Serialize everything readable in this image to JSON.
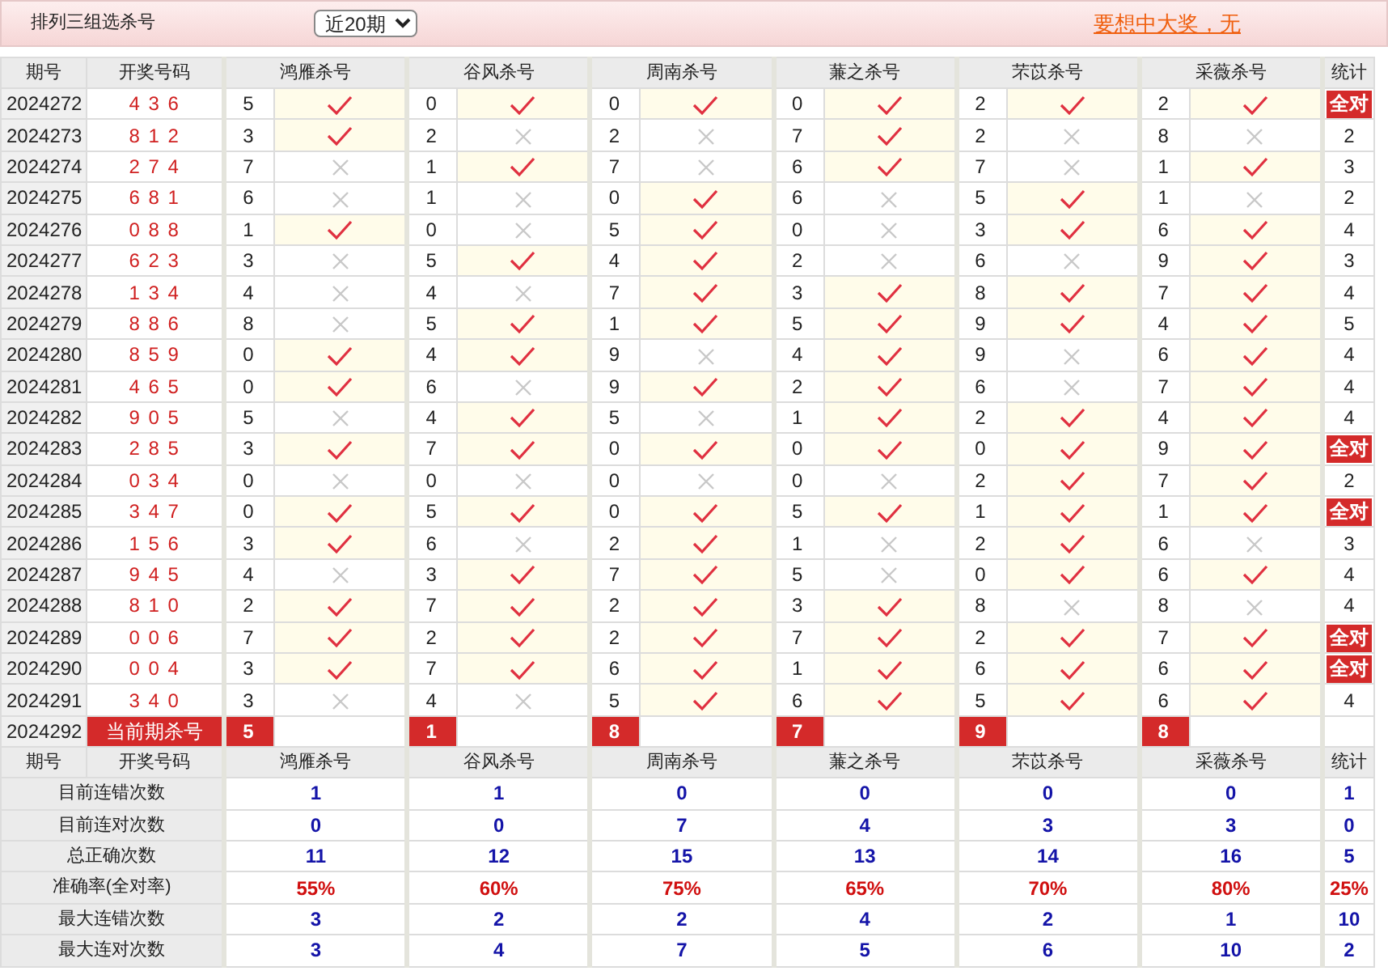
{
  "header": {
    "title": "排列三组选杀号",
    "period_select": {
      "value": "近20期"
    },
    "promo_link": "要想中大奖，无"
  },
  "table": {
    "columns": [
      "期号",
      "开奖号码",
      "鸿雁杀号",
      "谷风杀号",
      "周南杀号",
      "蒹之杀号",
      "芣苡杀号",
      "采薇杀号",
      "统计"
    ],
    "rows": [
      {
        "period": "2024272",
        "draw": "4 3 6",
        "kills": [
          {
            "number": "5",
            "hit": true
          },
          {
            "number": "0",
            "hit": true
          },
          {
            "number": "0",
            "hit": true
          },
          {
            "number": "0",
            "hit": true
          },
          {
            "number": "2",
            "hit": true
          },
          {
            "number": "2",
            "hit": true
          }
        ],
        "stat": {
          "kind": "all",
          "text": "全对"
        }
      },
      {
        "period": "2024273",
        "draw": "8 1 2",
        "kills": [
          {
            "number": "3",
            "hit": true
          },
          {
            "number": "2",
            "hit": false
          },
          {
            "number": "2",
            "hit": false
          },
          {
            "number": "7",
            "hit": true
          },
          {
            "number": "2",
            "hit": false
          },
          {
            "number": "8",
            "hit": false
          }
        ],
        "stat": {
          "kind": "count",
          "text": "2"
        }
      },
      {
        "period": "2024274",
        "draw": "2 7 4",
        "kills": [
          {
            "number": "7",
            "hit": false
          },
          {
            "number": "1",
            "hit": true
          },
          {
            "number": "7",
            "hit": false
          },
          {
            "number": "6",
            "hit": true
          },
          {
            "number": "7",
            "hit": false
          },
          {
            "number": "1",
            "hit": true
          }
        ],
        "stat": {
          "kind": "count",
          "text": "3"
        }
      },
      {
        "period": "2024275",
        "draw": "6 8 1",
        "kills": [
          {
            "number": "6",
            "hit": false
          },
          {
            "number": "1",
            "hit": false
          },
          {
            "number": "0",
            "hit": true
          },
          {
            "number": "6",
            "hit": false
          },
          {
            "number": "5",
            "hit": true
          },
          {
            "number": "1",
            "hit": false
          }
        ],
        "stat": {
          "kind": "count",
          "text": "2"
        }
      },
      {
        "period": "2024276",
        "draw": "0 8 8",
        "kills": [
          {
            "number": "1",
            "hit": true
          },
          {
            "number": "0",
            "hit": false
          },
          {
            "number": "5",
            "hit": true
          },
          {
            "number": "0",
            "hit": false
          },
          {
            "number": "3",
            "hit": true
          },
          {
            "number": "6",
            "hit": true
          }
        ],
        "stat": {
          "kind": "count",
          "text": "4"
        }
      },
      {
        "period": "2024277",
        "draw": "6 2 3",
        "kills": [
          {
            "number": "3",
            "hit": false
          },
          {
            "number": "5",
            "hit": true
          },
          {
            "number": "4",
            "hit": true
          },
          {
            "number": "2",
            "hit": false
          },
          {
            "number": "6",
            "hit": false
          },
          {
            "number": "9",
            "hit": true
          }
        ],
        "stat": {
          "kind": "count",
          "text": "3"
        }
      },
      {
        "period": "2024278",
        "draw": "1 3 4",
        "kills": [
          {
            "number": "4",
            "hit": false
          },
          {
            "number": "4",
            "hit": false
          },
          {
            "number": "7",
            "hit": true
          },
          {
            "number": "3",
            "hit": true
          },
          {
            "number": "8",
            "hit": true
          },
          {
            "number": "7",
            "hit": true
          }
        ],
        "stat": {
          "kind": "count",
          "text": "4"
        }
      },
      {
        "period": "2024279",
        "draw": "8 8 6",
        "kills": [
          {
            "number": "8",
            "hit": false
          },
          {
            "number": "5",
            "hit": true
          },
          {
            "number": "1",
            "hit": true
          },
          {
            "number": "5",
            "hit": true
          },
          {
            "number": "9",
            "hit": true
          },
          {
            "number": "4",
            "hit": true
          }
        ],
        "stat": {
          "kind": "count",
          "text": "5"
        }
      },
      {
        "period": "2024280",
        "draw": "8 5 9",
        "kills": [
          {
            "number": "0",
            "hit": true
          },
          {
            "number": "4",
            "hit": true
          },
          {
            "number": "9",
            "hit": false
          },
          {
            "number": "4",
            "hit": true
          },
          {
            "number": "9",
            "hit": false
          },
          {
            "number": "6",
            "hit": true
          }
        ],
        "stat": {
          "kind": "count",
          "text": "4"
        }
      },
      {
        "period": "2024281",
        "draw": "4 6 5",
        "kills": [
          {
            "number": "0",
            "hit": true
          },
          {
            "number": "6",
            "hit": false
          },
          {
            "number": "9",
            "hit": true
          },
          {
            "number": "2",
            "hit": true
          },
          {
            "number": "6",
            "hit": false
          },
          {
            "number": "7",
            "hit": true
          }
        ],
        "stat": {
          "kind": "count",
          "text": "4"
        }
      },
      {
        "period": "2024282",
        "draw": "9 0 5",
        "kills": [
          {
            "number": "5",
            "hit": false
          },
          {
            "number": "4",
            "hit": true
          },
          {
            "number": "5",
            "hit": false
          },
          {
            "number": "1",
            "hit": true
          },
          {
            "number": "2",
            "hit": true
          },
          {
            "number": "4",
            "hit": true
          }
        ],
        "stat": {
          "kind": "count",
          "text": "4"
        }
      },
      {
        "period": "2024283",
        "draw": "2 8 5",
        "kills": [
          {
            "number": "3",
            "hit": true
          },
          {
            "number": "7",
            "hit": true
          },
          {
            "number": "0",
            "hit": true
          },
          {
            "number": "0",
            "hit": true
          },
          {
            "number": "0",
            "hit": true
          },
          {
            "number": "9",
            "hit": true
          }
        ],
        "stat": {
          "kind": "all",
          "text": "全对"
        }
      },
      {
        "period": "2024284",
        "draw": "0 3 4",
        "kills": [
          {
            "number": "0",
            "hit": false
          },
          {
            "number": "0",
            "hit": false
          },
          {
            "number": "0",
            "hit": false
          },
          {
            "number": "0",
            "hit": false
          },
          {
            "number": "2",
            "hit": true
          },
          {
            "number": "7",
            "hit": true
          }
        ],
        "stat": {
          "kind": "count",
          "text": "2"
        }
      },
      {
        "period": "2024285",
        "draw": "3 4 7",
        "kills": [
          {
            "number": "0",
            "hit": true
          },
          {
            "number": "5",
            "hit": true
          },
          {
            "number": "0",
            "hit": true
          },
          {
            "number": "5",
            "hit": true
          },
          {
            "number": "1",
            "hit": true
          },
          {
            "number": "1",
            "hit": true
          }
        ],
        "stat": {
          "kind": "all",
          "text": "全对"
        }
      },
      {
        "period": "2024286",
        "draw": "1 5 6",
        "kills": [
          {
            "number": "3",
            "hit": true
          },
          {
            "number": "6",
            "hit": false
          },
          {
            "number": "2",
            "hit": true
          },
          {
            "number": "1",
            "hit": false
          },
          {
            "number": "2",
            "hit": true
          },
          {
            "number": "6",
            "hit": false
          }
        ],
        "stat": {
          "kind": "count",
          "text": "3"
        }
      },
      {
        "period": "2024287",
        "draw": "9 4 5",
        "kills": [
          {
            "number": "4",
            "hit": false
          },
          {
            "number": "3",
            "hit": true
          },
          {
            "number": "7",
            "hit": true
          },
          {
            "number": "5",
            "hit": false
          },
          {
            "number": "0",
            "hit": true
          },
          {
            "number": "6",
            "hit": true
          }
        ],
        "stat": {
          "kind": "count",
          "text": "4"
        }
      },
      {
        "period": "2024288",
        "draw": "8 1 0",
        "kills": [
          {
            "number": "2",
            "hit": true
          },
          {
            "number": "7",
            "hit": true
          },
          {
            "number": "2",
            "hit": true
          },
          {
            "number": "3",
            "hit": true
          },
          {
            "number": "8",
            "hit": false
          },
          {
            "number": "8",
            "hit": false
          }
        ],
        "stat": {
          "kind": "count",
          "text": "4"
        }
      },
      {
        "period": "2024289",
        "draw": "0 0 6",
        "kills": [
          {
            "number": "7",
            "hit": true
          },
          {
            "number": "2",
            "hit": true
          },
          {
            "number": "2",
            "hit": true
          },
          {
            "number": "7",
            "hit": true
          },
          {
            "number": "2",
            "hit": true
          },
          {
            "number": "7",
            "hit": true
          }
        ],
        "stat": {
          "kind": "all",
          "text": "全对"
        }
      },
      {
        "period": "2024290",
        "draw": "0 0 4",
        "kills": [
          {
            "number": "3",
            "hit": true
          },
          {
            "number": "7",
            "hit": true
          },
          {
            "number": "6",
            "hit": true
          },
          {
            "number": "1",
            "hit": true
          },
          {
            "number": "6",
            "hit": true
          },
          {
            "number": "6",
            "hit": true
          }
        ],
        "stat": {
          "kind": "all",
          "text": "全对"
        }
      },
      {
        "period": "2024291",
        "draw": "3 4 0",
        "kills": [
          {
            "number": "3",
            "hit": false
          },
          {
            "number": "4",
            "hit": false
          },
          {
            "number": "5",
            "hit": true
          },
          {
            "number": "6",
            "hit": true
          },
          {
            "number": "5",
            "hit": true
          },
          {
            "number": "6",
            "hit": true
          }
        ],
        "stat": {
          "kind": "count",
          "text": "4"
        }
      }
    ],
    "current": {
      "period": "2024292",
      "label": "当前期杀号",
      "kills": [
        "5",
        "1",
        "8",
        "7",
        "9",
        "8"
      ]
    }
  },
  "summary": {
    "columns": [
      "期号",
      "开奖号码",
      "鸿雁杀号",
      "谷风杀号",
      "周南杀号",
      "蒹之杀号",
      "芣苡杀号",
      "采薇杀号",
      "统计"
    ],
    "rows": [
      {
        "label": "目前连错次数",
        "kind": "count",
        "values": [
          "1",
          "1",
          "0",
          "0",
          "0",
          "0"
        ],
        "total": "1"
      },
      {
        "label": "目前连对次数",
        "kind": "count",
        "values": [
          "0",
          "0",
          "7",
          "4",
          "3",
          "3"
        ],
        "total": "0"
      },
      {
        "label": "总正确次数",
        "kind": "count",
        "values": [
          "11",
          "12",
          "15",
          "13",
          "14",
          "16"
        ],
        "total": "5"
      },
      {
        "label": "准确率(全对率)",
        "kind": "rate",
        "values": [
          "55%",
          "60%",
          "75%",
          "65%",
          "70%",
          "80%"
        ],
        "total": "25%"
      },
      {
        "label": "最大连错次数",
        "kind": "count",
        "values": [
          "3",
          "2",
          "2",
          "4",
          "2",
          "1"
        ],
        "total": "10"
      },
      {
        "label": "最大连对次数",
        "kind": "count",
        "values": [
          "3",
          "4",
          "7",
          "5",
          "6",
          "10"
        ],
        "total": "2"
      }
    ]
  }
}
